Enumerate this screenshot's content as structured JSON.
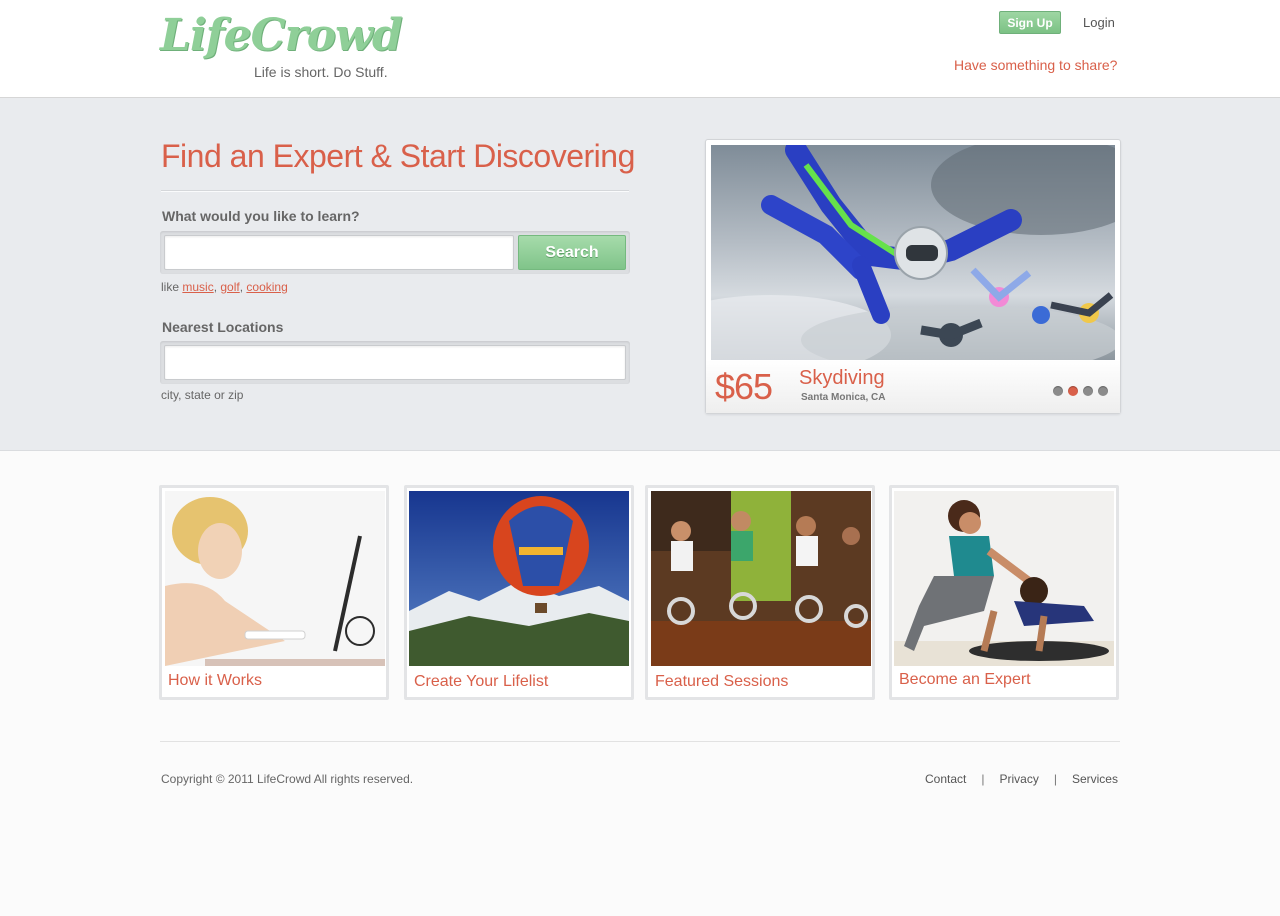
{
  "header": {
    "logo": "LifeCrowd",
    "tagline": "Life is short. Do Stuff.",
    "signup_label": "Sign Up",
    "login_label": "Login",
    "share_label": "Have something to share?"
  },
  "hero": {
    "title": "Find an Expert & Start Discovering",
    "learn_label": "What would you like to learn?",
    "learn_value": "",
    "search_label": "Search",
    "hint_prefix": "like",
    "examples": [
      "music",
      "golf",
      "cooking"
    ],
    "location_label": "Nearest Locations",
    "location_value": "",
    "location_hint": "city, state or zip"
  },
  "featured": {
    "price": "$65",
    "activity": "Skydiving",
    "location": "Santa Monica, CA",
    "slides": 4,
    "active_slide": 2
  },
  "tiles": [
    {
      "label": "How it Works"
    },
    {
      "label": "Create Your Lifelist"
    },
    {
      "label": "Featured Sessions"
    },
    {
      "label": "Become an Expert"
    }
  ],
  "footer": {
    "copyright": "Copyright © 2011 LifeCrowd All rights reserved.",
    "links": [
      "Contact",
      "Privacy",
      "Services"
    ],
    "separator": "|"
  },
  "colors": {
    "accent": "#d9604a",
    "brand_green": "#8fcf98"
  }
}
